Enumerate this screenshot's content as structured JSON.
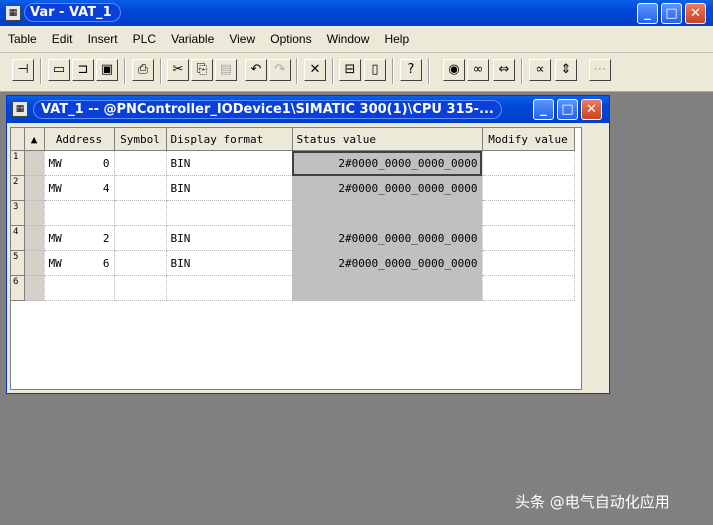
{
  "app": {
    "title": "Var - VAT_1"
  },
  "menu": [
    "Table",
    "Edit",
    "Insert",
    "PLC",
    "Variable",
    "View",
    "Options",
    "Window",
    "Help"
  ],
  "child_window": {
    "title": "VAT_1 -- @PNController_IODevice1\\SIMATIC 300(1)\\CPU 315-..."
  },
  "table": {
    "headers": [
      "Address",
      "Symbol",
      "Display format",
      "Status value",
      "Modify value"
    ],
    "rows": [
      {
        "num": "1",
        "op": "MW",
        "addr": "0",
        "symbol": "",
        "format": "BIN",
        "status": "2#0000_0000_0000_0000",
        "modify": ""
      },
      {
        "num": "2",
        "op": "MW",
        "addr": "4",
        "symbol": "",
        "format": "BIN",
        "status": "2#0000_0000_0000_0000",
        "modify": ""
      },
      {
        "num": "3",
        "op": "",
        "addr": "",
        "symbol": "",
        "format": "",
        "status": "",
        "modify": ""
      },
      {
        "num": "4",
        "op": "MW",
        "addr": "2",
        "symbol": "",
        "format": "BIN",
        "status": "2#0000_0000_0000_0000",
        "modify": ""
      },
      {
        "num": "5",
        "op": "MW",
        "addr": "6",
        "symbol": "",
        "format": "BIN",
        "status": "2#0000_0000_0000_0000",
        "modify": ""
      },
      {
        "num": "6",
        "op": "",
        "addr": "",
        "symbol": "",
        "format": "",
        "status": "",
        "modify": ""
      }
    ]
  },
  "watermark": "头条 @电气自动化应用"
}
